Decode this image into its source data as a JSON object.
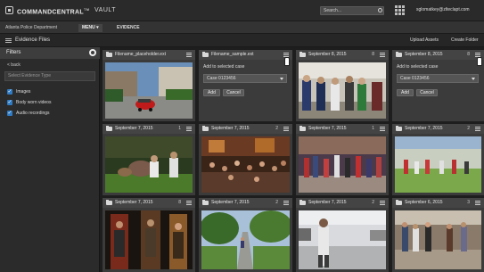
{
  "topbar": {
    "brand": "COMMANDCENTRAL",
    "brand_tm": "TM",
    "product": "VAULT",
    "search_placeholder": "Search...",
    "user_email": "sglomatkey@zlteclapt.com"
  },
  "nav": {
    "department": "Atlanta Police Department",
    "menu_label": "MENU ▾",
    "evidence_label": "EVIDENCE"
  },
  "subbar": {
    "title": "Evidence Files",
    "upload_label": "Upload Assets",
    "create_folder_label": "Create Folder"
  },
  "sidebar": {
    "title": "Filters",
    "back_label": "< back",
    "select_placeholder": "Select Evidence Type",
    "types": [
      {
        "label": "Images",
        "checked": true
      },
      {
        "label": "Body worn videos",
        "checked": true
      },
      {
        "label": "Audio recordings",
        "checked": true
      }
    ]
  },
  "add_to_case": {
    "title": "Add to selected case",
    "case_value": "Case 0123456",
    "add_label": "Add",
    "cancel_label": "Cancel"
  },
  "tiles": [
    {
      "title": "Filename_placeholder.ext",
      "count": "",
      "type": "photo"
    },
    {
      "title": "Filename_sample.ext",
      "count": "",
      "type": "add"
    },
    {
      "title": "September 8, 2015",
      "count": "8",
      "type": "photo"
    },
    {
      "title": "September 8, 2015",
      "count": "8",
      "type": "add"
    },
    {
      "title": "September 7, 2015",
      "count": "1",
      "type": "photo"
    },
    {
      "title": "September 7, 2015",
      "count": "2",
      "type": "photo"
    },
    {
      "title": "September 7, 2015",
      "count": "1",
      "type": "photo"
    },
    {
      "title": "September 7, 2015",
      "count": "2",
      "type": "photo"
    },
    {
      "title": "September 7, 2015",
      "count": "8",
      "type": "photo"
    },
    {
      "title": "September 7, 2015",
      "count": "2",
      "type": "photo"
    },
    {
      "title": "September 7, 2015",
      "count": "2",
      "type": "photo"
    },
    {
      "title": "September 6, 2015",
      "count": "3",
      "type": "photo"
    }
  ]
}
